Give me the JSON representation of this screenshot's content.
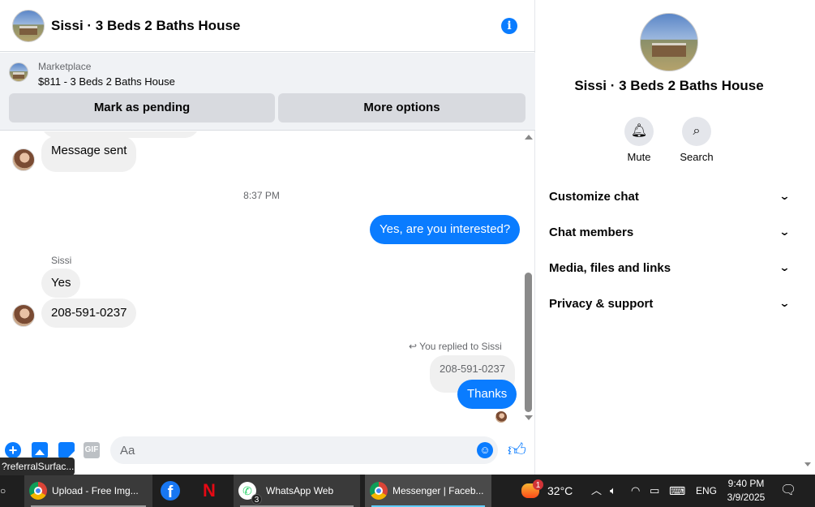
{
  "header": {
    "title": "Sissi · 3 Beds 2 Baths House",
    "info_icon": "info-icon"
  },
  "marketplace": {
    "label": "Marketplace",
    "listing": "$811 - 3 Beds 2 Baths House",
    "mark_pending": "Mark as pending",
    "more_options": "More options"
  },
  "messages": {
    "message_sent": "Message sent",
    "timestamp": "8:37 PM",
    "out_interested": "Yes, are you interested?",
    "sender": "Sissi",
    "in_yes": "Yes",
    "in_phone": "208-591-0237",
    "reply_note": "You replied to Sissi",
    "replied_quote": "208-591-0237",
    "out_thanks": "Thanks"
  },
  "composer": {
    "placeholder": "Aa",
    "gif_label": "GIF"
  },
  "tooltip": "?referralSurfac...",
  "details": {
    "title": "Sissi · 3 Beds 2 Baths House",
    "actions": [
      {
        "label": "Mute",
        "icon": "bell-icon"
      },
      {
        "label": "Search",
        "icon": "search-icon"
      }
    ],
    "sections": [
      "Customize chat",
      "Chat members",
      "Media, files and links",
      "Privacy & support"
    ]
  },
  "taskbar": {
    "apps": [
      {
        "label": "Upload - Free Img...",
        "icon": "chrome-icon"
      },
      {
        "label": "",
        "icon": "facebook-icon"
      },
      {
        "label": "",
        "icon": "netflix-icon"
      },
      {
        "label": "WhatsApp Web",
        "icon": "whatsapp-icon",
        "badge": "3"
      },
      {
        "label": "Messenger | Faceb...",
        "icon": "chrome-icon"
      }
    ],
    "weather": {
      "temp": "32°C",
      "badge": "1"
    },
    "language": "ENG",
    "time": "9:40 PM",
    "date": "3/9/2025"
  },
  "colors": {
    "accent": "#0a7cff",
    "bubble_in": "#f0f0f0",
    "taskbar": "#1f1f1f"
  }
}
